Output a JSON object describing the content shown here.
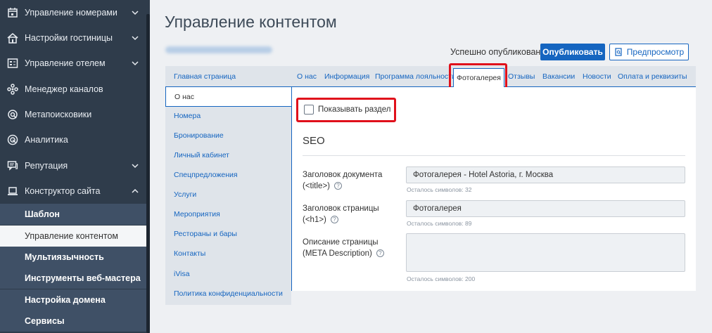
{
  "sidebar": {
    "items": [
      {
        "label": "Управление номерами",
        "icon": "calendar-icon"
      },
      {
        "label": "Настройки гостиницы",
        "icon": "hotel-icon"
      },
      {
        "label": "Управление отелем",
        "icon": "dashboard-icon"
      },
      {
        "label": "Менеджер каналов",
        "icon": "channels-icon"
      },
      {
        "label": "Метапоисковики",
        "icon": "search-icon"
      },
      {
        "label": "Аналитика",
        "icon": "analytics-icon"
      },
      {
        "label": "Репутация",
        "icon": "chat-icon"
      },
      {
        "label": "Конструктор сайта",
        "icon": "laptop-icon"
      }
    ],
    "sub_items": [
      {
        "label": "Шаблон"
      },
      {
        "label": "Управление контентом"
      },
      {
        "label": "Мультиязычность"
      },
      {
        "label": "Инструменты веб-мастера"
      },
      {
        "label": "Настройка домена"
      },
      {
        "label": "Сервисы"
      }
    ]
  },
  "header": {
    "title": "Управление контентом",
    "status": "Успешно опубликовано",
    "publish_label": "Опубликовать",
    "preview_label": "Предпросмотр"
  },
  "pages_nav": {
    "items": [
      "Главная страница",
      "О нас",
      "Номера",
      "Бронирование",
      "Личный кабинет",
      "Спецпредложения",
      "Услуги",
      "Мероприятия",
      "Рестораны и бары",
      "Контакты",
      "iVisa",
      "Политика конфиденциальности"
    ],
    "active": "О нас"
  },
  "tabs": {
    "items": [
      "О нас",
      "Информация",
      "Программа лояльности",
      "Фотогалерея",
      "Отзывы",
      "Вакансии",
      "Новости",
      "Оплата и реквизиты"
    ],
    "active": "Фотогалерея"
  },
  "content": {
    "show_section_label": "Показывать раздел",
    "show_section_checked": false,
    "seo_title": "SEO",
    "doc_title_label_1": "Заголовок документа",
    "doc_title_label_2": "(<title>)",
    "doc_title_value": "Фотогалерея - Hotel Astoria, г. Москва",
    "doc_title_hint": "Осталось символов: 32",
    "page_title_label_1": "Заголовок страницы",
    "page_title_label_2": "(<h1>)",
    "page_title_value": "Фотогалерея",
    "page_title_hint": "Осталось символов: 89",
    "meta_label_1": "Описание страницы",
    "meta_label_2": "(META Description)",
    "meta_value": "",
    "meta_hint": "Осталось символов: 200",
    "help_glyph": "?"
  },
  "colors": {
    "sidebar_bg": "#2f3c4b",
    "accent": "#1565c0",
    "highlight": "#e0101b"
  }
}
